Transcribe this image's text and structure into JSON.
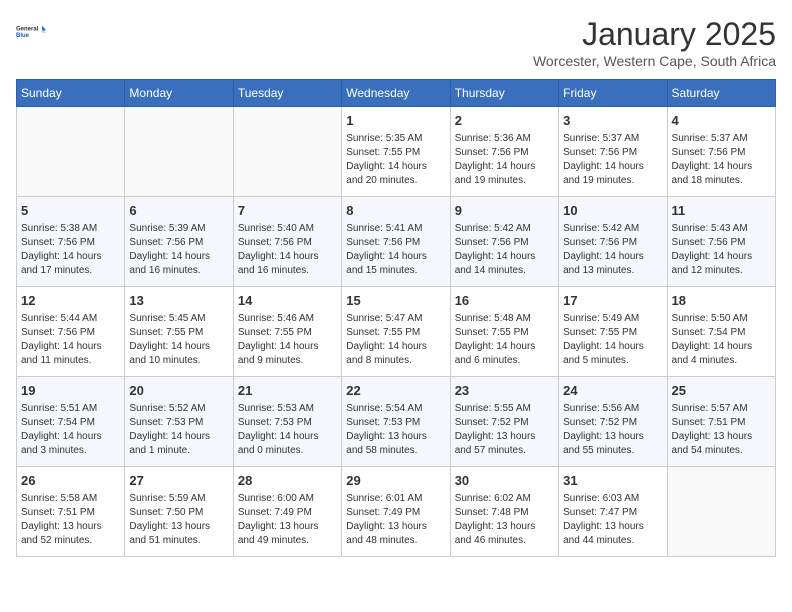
{
  "header": {
    "logo_line1": "General",
    "logo_line2": "Blue",
    "title": "January 2025",
    "subtitle": "Worcester, Western Cape, South Africa"
  },
  "days_of_week": [
    "Sunday",
    "Monday",
    "Tuesday",
    "Wednesday",
    "Thursday",
    "Friday",
    "Saturday"
  ],
  "weeks": [
    [
      {
        "day": "",
        "info": ""
      },
      {
        "day": "",
        "info": ""
      },
      {
        "day": "",
        "info": ""
      },
      {
        "day": "1",
        "info": "Sunrise: 5:35 AM\nSunset: 7:55 PM\nDaylight: 14 hours\nand 20 minutes."
      },
      {
        "day": "2",
        "info": "Sunrise: 5:36 AM\nSunset: 7:56 PM\nDaylight: 14 hours\nand 19 minutes."
      },
      {
        "day": "3",
        "info": "Sunrise: 5:37 AM\nSunset: 7:56 PM\nDaylight: 14 hours\nand 19 minutes."
      },
      {
        "day": "4",
        "info": "Sunrise: 5:37 AM\nSunset: 7:56 PM\nDaylight: 14 hours\nand 18 minutes."
      }
    ],
    [
      {
        "day": "5",
        "info": "Sunrise: 5:38 AM\nSunset: 7:56 PM\nDaylight: 14 hours\nand 17 minutes."
      },
      {
        "day": "6",
        "info": "Sunrise: 5:39 AM\nSunset: 7:56 PM\nDaylight: 14 hours\nand 16 minutes."
      },
      {
        "day": "7",
        "info": "Sunrise: 5:40 AM\nSunset: 7:56 PM\nDaylight: 14 hours\nand 16 minutes."
      },
      {
        "day": "8",
        "info": "Sunrise: 5:41 AM\nSunset: 7:56 PM\nDaylight: 14 hours\nand 15 minutes."
      },
      {
        "day": "9",
        "info": "Sunrise: 5:42 AM\nSunset: 7:56 PM\nDaylight: 14 hours\nand 14 minutes."
      },
      {
        "day": "10",
        "info": "Sunrise: 5:42 AM\nSunset: 7:56 PM\nDaylight: 14 hours\nand 13 minutes."
      },
      {
        "day": "11",
        "info": "Sunrise: 5:43 AM\nSunset: 7:56 PM\nDaylight: 14 hours\nand 12 minutes."
      }
    ],
    [
      {
        "day": "12",
        "info": "Sunrise: 5:44 AM\nSunset: 7:56 PM\nDaylight: 14 hours\nand 11 minutes."
      },
      {
        "day": "13",
        "info": "Sunrise: 5:45 AM\nSunset: 7:55 PM\nDaylight: 14 hours\nand 10 minutes."
      },
      {
        "day": "14",
        "info": "Sunrise: 5:46 AM\nSunset: 7:55 PM\nDaylight: 14 hours\nand 9 minutes."
      },
      {
        "day": "15",
        "info": "Sunrise: 5:47 AM\nSunset: 7:55 PM\nDaylight: 14 hours\nand 8 minutes."
      },
      {
        "day": "16",
        "info": "Sunrise: 5:48 AM\nSunset: 7:55 PM\nDaylight: 14 hours\nand 6 minutes."
      },
      {
        "day": "17",
        "info": "Sunrise: 5:49 AM\nSunset: 7:55 PM\nDaylight: 14 hours\nand 5 minutes."
      },
      {
        "day": "18",
        "info": "Sunrise: 5:50 AM\nSunset: 7:54 PM\nDaylight: 14 hours\nand 4 minutes."
      }
    ],
    [
      {
        "day": "19",
        "info": "Sunrise: 5:51 AM\nSunset: 7:54 PM\nDaylight: 14 hours\nand 3 minutes."
      },
      {
        "day": "20",
        "info": "Sunrise: 5:52 AM\nSunset: 7:53 PM\nDaylight: 14 hours\nand 1 minute."
      },
      {
        "day": "21",
        "info": "Sunrise: 5:53 AM\nSunset: 7:53 PM\nDaylight: 14 hours\nand 0 minutes."
      },
      {
        "day": "22",
        "info": "Sunrise: 5:54 AM\nSunset: 7:53 PM\nDaylight: 13 hours\nand 58 minutes."
      },
      {
        "day": "23",
        "info": "Sunrise: 5:55 AM\nSunset: 7:52 PM\nDaylight: 13 hours\nand 57 minutes."
      },
      {
        "day": "24",
        "info": "Sunrise: 5:56 AM\nSunset: 7:52 PM\nDaylight: 13 hours\nand 55 minutes."
      },
      {
        "day": "25",
        "info": "Sunrise: 5:57 AM\nSunset: 7:51 PM\nDaylight: 13 hours\nand 54 minutes."
      }
    ],
    [
      {
        "day": "26",
        "info": "Sunrise: 5:58 AM\nSunset: 7:51 PM\nDaylight: 13 hours\nand 52 minutes."
      },
      {
        "day": "27",
        "info": "Sunrise: 5:59 AM\nSunset: 7:50 PM\nDaylight: 13 hours\nand 51 minutes."
      },
      {
        "day": "28",
        "info": "Sunrise: 6:00 AM\nSunset: 7:49 PM\nDaylight: 13 hours\nand 49 minutes."
      },
      {
        "day": "29",
        "info": "Sunrise: 6:01 AM\nSunset: 7:49 PM\nDaylight: 13 hours\nand 48 minutes."
      },
      {
        "day": "30",
        "info": "Sunrise: 6:02 AM\nSunset: 7:48 PM\nDaylight: 13 hours\nand 46 minutes."
      },
      {
        "day": "31",
        "info": "Sunrise: 6:03 AM\nSunset: 7:47 PM\nDaylight: 13 hours\nand 44 minutes."
      },
      {
        "day": "",
        "info": ""
      }
    ]
  ]
}
